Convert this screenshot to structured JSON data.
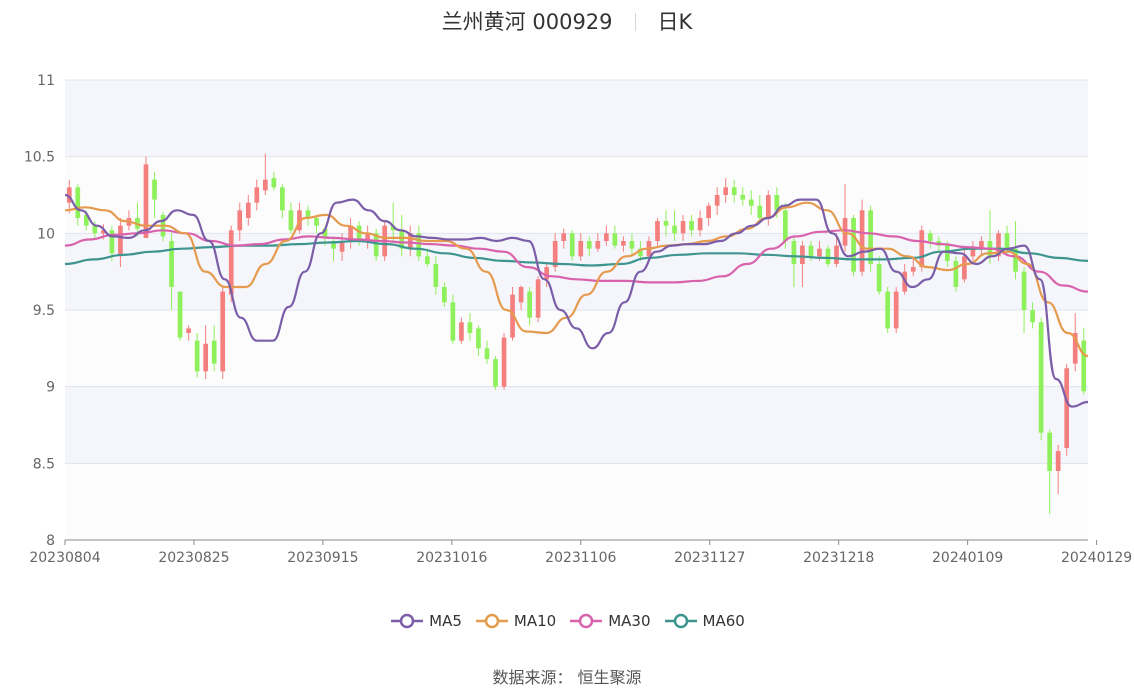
{
  "header": {
    "stock": "兰州黄河 000929",
    "period": "日K"
  },
  "source_note": "数据来源： 恒生聚源",
  "colors": {
    "up": "#f47f7f",
    "down": "#8ef05a",
    "ma5": "#7b5ea7",
    "ma10": "#e59a4e",
    "ma30": "#d962ad",
    "ma60": "#3e9590"
  },
  "chart_data": {
    "type": "candlestick",
    "title": "兰州黄河 000929",
    "ylim": [
      8,
      11
    ],
    "y_ticks": [
      "11",
      "10.5",
      "10",
      "9.5",
      "9",
      "8.5",
      "8"
    ],
    "x_tick_labels": [
      "20230804",
      "20230825",
      "20230915",
      "20231016",
      "20231106",
      "20231127",
      "20231218",
      "20240109",
      "20240129"
    ],
    "x_tick_index": [
      0,
      15,
      30,
      45,
      60,
      75,
      90,
      105,
      120
    ],
    "legend": [
      "MA5",
      "MA10",
      "MA30",
      "MA60"
    ],
    "legend_position": "bottom",
    "candles": [
      [
        10.2,
        10.3,
        10.13,
        10.35
      ],
      [
        10.3,
        10.1,
        10.05,
        10.32
      ],
      [
        10.12,
        10.05,
        10.02,
        10.15
      ],
      [
        10.05,
        10.0,
        9.97,
        10.08
      ],
      [
        10.0,
        10.02,
        9.96,
        10.06
      ],
      [
        10.02,
        9.87,
        9.82,
        10.05
      ],
      [
        9.85,
        10.05,
        9.78,
        10.1
      ],
      [
        10.05,
        10.1,
        10.02,
        10.15
      ],
      [
        10.1,
        10.03,
        9.98,
        10.2
      ],
      [
        9.97,
        10.45,
        9.97,
        10.5
      ],
      [
        10.35,
        10.22,
        10.1,
        10.4
      ],
      [
        10.12,
        9.98,
        9.95,
        10.14
      ],
      [
        9.95,
        9.65,
        9.5,
        10.0
      ],
      [
        9.62,
        9.32,
        9.3,
        9.62
      ],
      [
        9.35,
        9.38,
        9.3,
        9.4
      ],
      [
        9.3,
        9.1,
        9.06,
        9.35
      ],
      [
        9.1,
        9.28,
        9.05,
        9.4
      ],
      [
        9.3,
        9.15,
        9.1,
        9.4
      ],
      [
        9.1,
        9.62,
        9.05,
        9.65
      ],
      [
        9.6,
        10.02,
        9.55,
        10.05
      ],
      [
        10.02,
        10.15,
        9.95,
        10.2
      ],
      [
        10.1,
        10.2,
        10.05,
        10.25
      ],
      [
        10.2,
        10.3,
        10.15,
        10.35
      ],
      [
        10.28,
        10.35,
        10.25,
        10.52
      ],
      [
        10.36,
        10.3,
        10.28,
        10.4
      ],
      [
        10.3,
        10.15,
        10.1,
        10.32
      ],
      [
        10.15,
        10.02,
        10.0,
        10.2
      ],
      [
        10.02,
        10.15,
        10.0,
        10.2
      ],
      [
        10.15,
        10.1,
        10.05,
        10.18
      ],
      [
        10.1,
        10.05,
        10.0,
        10.12
      ],
      [
        10.03,
        9.97,
        9.92,
        10.05
      ],
      [
        9.95,
        9.9,
        9.82,
        9.98
      ],
      [
        9.88,
        9.95,
        9.82,
        10.0
      ],
      [
        9.95,
        10.05,
        9.9,
        10.1
      ],
      [
        10.05,
        9.95,
        9.92,
        10.08
      ],
      [
        9.95,
        10.0,
        9.9,
        10.05
      ],
      [
        10.0,
        9.85,
        9.82,
        10.03
      ],
      [
        9.85,
        10.05,
        9.82,
        10.08
      ],
      [
        10.05,
        10.02,
        9.95,
        10.2
      ],
      [
        10.02,
        9.9,
        9.85,
        10.12
      ],
      [
        9.9,
        10.0,
        9.85,
        10.05
      ],
      [
        10.0,
        9.85,
        9.82,
        10.05
      ],
      [
        9.85,
        9.8,
        9.78,
        9.9
      ],
      [
        9.8,
        9.65,
        9.6,
        9.85
      ],
      [
        9.65,
        9.55,
        9.52,
        9.68
      ],
      [
        9.55,
        9.3,
        9.28,
        9.6
      ],
      [
        9.3,
        9.42,
        9.28,
        9.45
      ],
      [
        9.42,
        9.35,
        9.3,
        9.48
      ],
      [
        9.38,
        9.25,
        9.2,
        9.4
      ],
      [
        9.25,
        9.18,
        9.15,
        9.3
      ],
      [
        9.18,
        9.0,
        8.98,
        9.2
      ],
      [
        9.0,
        9.32,
        8.98,
        9.35
      ],
      [
        9.32,
        9.6,
        9.3,
        9.65
      ],
      [
        9.55,
        9.65,
        9.5,
        9.66
      ],
      [
        9.62,
        9.45,
        9.4,
        9.65
      ],
      [
        9.45,
        9.7,
        9.42,
        9.72
      ],
      [
        9.7,
        9.78,
        9.65,
        9.8
      ],
      [
        9.78,
        9.95,
        9.75,
        10.0
      ],
      [
        9.95,
        10.0,
        9.9,
        10.03
      ],
      [
        10.0,
        9.85,
        9.82,
        10.02
      ],
      [
        9.85,
        9.95,
        9.82,
        10.0
      ],
      [
        9.95,
        9.9,
        9.85,
        9.98
      ],
      [
        9.9,
        9.95,
        9.88,
        10.0
      ],
      [
        9.95,
        10.0,
        9.92,
        10.05
      ],
      [
        10.0,
        9.92,
        9.9,
        10.05
      ],
      [
        9.92,
        9.95,
        9.88,
        9.98
      ],
      [
        9.95,
        9.9,
        9.85,
        10.0
      ],
      [
        9.9,
        9.85,
        9.82,
        9.95
      ],
      [
        9.85,
        9.95,
        9.82,
        9.98
      ],
      [
        9.95,
        10.08,
        9.92,
        10.1
      ],
      [
        10.08,
        10.05,
        9.98,
        10.15
      ],
      [
        10.05,
        10.0,
        9.95,
        10.15
      ],
      [
        10.0,
        10.08,
        9.95,
        10.12
      ],
      [
        10.08,
        10.02,
        9.98,
        10.12
      ],
      [
        10.02,
        10.1,
        9.98,
        10.15
      ],
      [
        10.1,
        10.18,
        10.05,
        10.2
      ],
      [
        10.18,
        10.25,
        10.12,
        10.3
      ],
      [
        10.25,
        10.3,
        10.2,
        10.36
      ],
      [
        10.3,
        10.25,
        10.2,
        10.35
      ],
      [
        10.25,
        10.22,
        10.18,
        10.3
      ],
      [
        10.22,
        10.18,
        10.12,
        10.28
      ],
      [
        10.18,
        10.1,
        10.08,
        10.25
      ],
      [
        10.1,
        10.25,
        10.05,
        10.28
      ],
      [
        10.25,
        10.15,
        10.1,
        10.3
      ],
      [
        10.15,
        9.95,
        9.9,
        10.2
      ],
      [
        9.95,
        9.8,
        9.65,
        9.98
      ],
      [
        9.8,
        9.92,
        9.65,
        9.95
      ],
      [
        9.92,
        9.85,
        9.82,
        9.95
      ],
      [
        9.85,
        9.9,
        9.82,
        9.95
      ],
      [
        9.9,
        9.8,
        9.78,
        9.92
      ],
      [
        9.8,
        9.92,
        9.78,
        10.0
      ],
      [
        9.92,
        10.1,
        9.88,
        10.32
      ],
      [
        10.1,
        9.75,
        9.72,
        10.12
      ],
      [
        9.75,
        10.15,
        9.72,
        10.22
      ],
      [
        10.15,
        9.8,
        9.75,
        10.18
      ],
      [
        9.8,
        9.62,
        9.6,
        9.85
      ],
      [
        9.62,
        9.38,
        9.35,
        9.65
      ],
      [
        9.38,
        9.62,
        9.35,
        9.65
      ],
      [
        9.62,
        9.75,
        9.6,
        9.8
      ],
      [
        9.75,
        9.78,
        9.72,
        9.85
      ],
      [
        9.78,
        10.02,
        9.75,
        10.05
      ],
      [
        10.0,
        9.95,
        9.9,
        10.02
      ],
      [
        9.95,
        9.92,
        9.88,
        9.98
      ],
      [
        9.92,
        9.82,
        9.78,
        9.95
      ],
      [
        9.82,
        9.65,
        9.62,
        9.85
      ],
      [
        9.7,
        9.85,
        9.68,
        9.9
      ],
      [
        9.85,
        9.9,
        9.82,
        9.95
      ],
      [
        9.9,
        9.95,
        9.85,
        9.98
      ],
      [
        9.95,
        9.85,
        9.8,
        10.15
      ],
      [
        9.85,
        10.0,
        9.82,
        10.02
      ],
      [
        10.0,
        9.9,
        9.85,
        10.05
      ],
      [
        9.9,
        9.75,
        9.7,
        10.08
      ],
      [
        9.75,
        9.5,
        9.35,
        9.78
      ],
      [
        9.5,
        9.42,
        9.38,
        9.55
      ],
      [
        9.42,
        8.7,
        8.65,
        9.45
      ],
      [
        8.7,
        8.45,
        8.17,
        8.72
      ],
      [
        8.45,
        8.58,
        8.3,
        8.62
      ],
      [
        8.6,
        9.12,
        8.55,
        9.15
      ],
      [
        9.15,
        9.35,
        9.1,
        9.48
      ],
      [
        9.3,
        8.97,
        8.95,
        9.38
      ]
    ],
    "ma5": [
      10.25,
      10.15,
      10.05,
      9.98,
      9.97,
      10.02,
      10.08,
      10.15,
      10.12,
      9.95,
      9.7,
      9.45,
      9.3,
      9.3,
      9.52,
      9.75,
      10.0,
      10.2,
      10.22,
      10.15,
      10.08,
      10.02,
      9.98,
      9.97,
      9.96,
      9.96,
      9.97,
      9.95,
      9.97,
      9.95,
      9.7,
      9.5,
      9.38,
      9.25,
      9.35,
      9.55,
      9.75,
      9.88,
      9.92,
      9.93,
      9.93,
      9.95,
      10.0,
      10.05,
      10.1,
      10.18,
      10.22,
      10.22,
      10.0,
      9.85,
      9.88,
      9.9,
      9.75,
      9.65,
      9.7,
      9.88,
      9.87,
      9.8,
      9.85,
      9.9,
      9.92,
      9.7,
      9.05,
      8.87,
      8.9
    ],
    "ma10": [
      10.15,
      10.17,
      10.15,
      10.08,
      10.05,
      10.05,
      10.0,
      9.75,
      9.65,
      9.65,
      9.8,
      9.95,
      10.1,
      10.12,
      10.05,
      10.0,
      9.97,
      9.97,
      9.95,
      9.95,
      9.9,
      9.75,
      9.5,
      9.36,
      9.35,
      9.45,
      9.6,
      9.75,
      9.85,
      9.9,
      9.92,
      9.93,
      9.95,
      9.98,
      10.03,
      10.1,
      10.17,
      10.2,
      10.15,
      10.0,
      9.9,
      9.9,
      9.85,
      9.78,
      9.76,
      9.8,
      9.87,
      9.88,
      9.8,
      9.55,
      9.35,
      9.2
    ],
    "ma30": [
      9.92,
      9.96,
      9.99,
      10.0,
      10.02,
      10.0,
      9.95,
      9.92,
      9.93,
      9.96,
      9.98,
      9.97,
      9.96,
      9.95,
      9.94,
      9.93,
      9.92,
      9.9,
      9.88,
      9.78,
      9.72,
      9.7,
      9.69,
      9.69,
      9.68,
      9.68,
      9.69,
      9.72,
      9.8,
      9.9,
      9.98,
      10.01,
      10.02,
      10.0,
      9.98,
      9.95,
      9.93,
      9.91,
      9.9,
      9.85,
      9.75,
      9.66,
      9.62
    ],
    "ma60": [
      9.8,
      9.83,
      9.86,
      9.88,
      9.9,
      9.91,
      9.92,
      9.92,
      9.93,
      9.94,
      9.95,
      9.93,
      9.9,
      9.87,
      9.84,
      9.82,
      9.81,
      9.8,
      9.79,
      9.8,
      9.84,
      9.86,
      9.87,
      9.87,
      9.86,
      9.85,
      9.84,
      9.83,
      9.83,
      9.84,
      9.88,
      9.9,
      9.9,
      9.87,
      9.84,
      9.82
    ]
  }
}
